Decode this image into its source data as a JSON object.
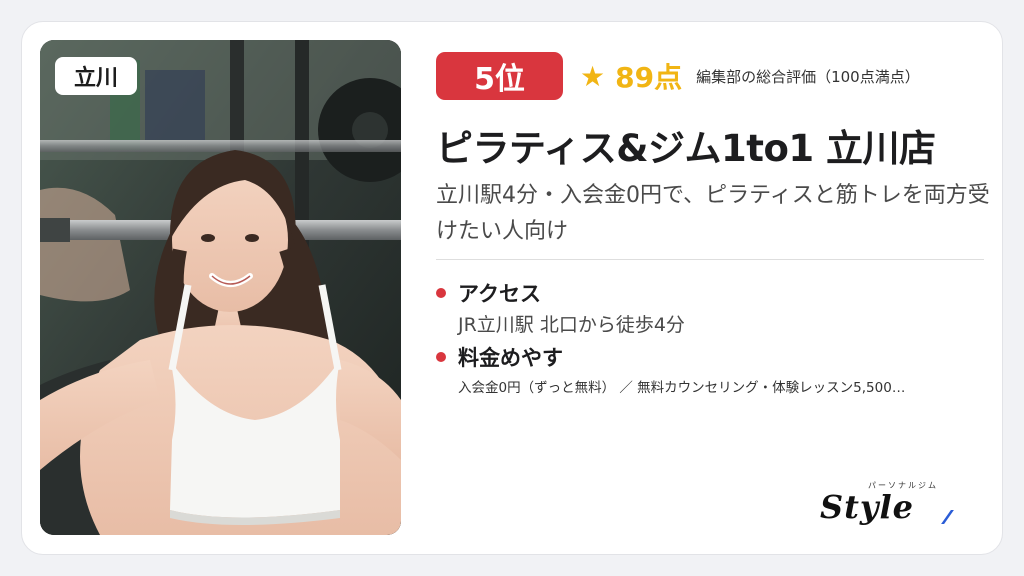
{
  "area_tag": "立川",
  "rank": "5位",
  "rating": {
    "star": "★",
    "score": "89点",
    "note": "編集部の総合評価（100点満点）"
  },
  "title": "ピラティス&ジム1to1 立川店",
  "subtitle": "立川駅4分・入会金0円で、ピラティスと筋トレを両方受けたい人向け",
  "access": {
    "heading": "アクセス",
    "value": "JR立川駅 北口から徒歩4分"
  },
  "price": {
    "heading": "料金めやす",
    "value": "入会金0円（ずっと無料） ／ 無料カウンセリング・体験レッスン5,500…"
  },
  "brand": {
    "kana": "パーソナルジム",
    "word": "Style"
  },
  "colors": {
    "accent_red": "#d9363e",
    "star_gold": "#f1b514",
    "brand_blue": "#2a5cd6"
  }
}
